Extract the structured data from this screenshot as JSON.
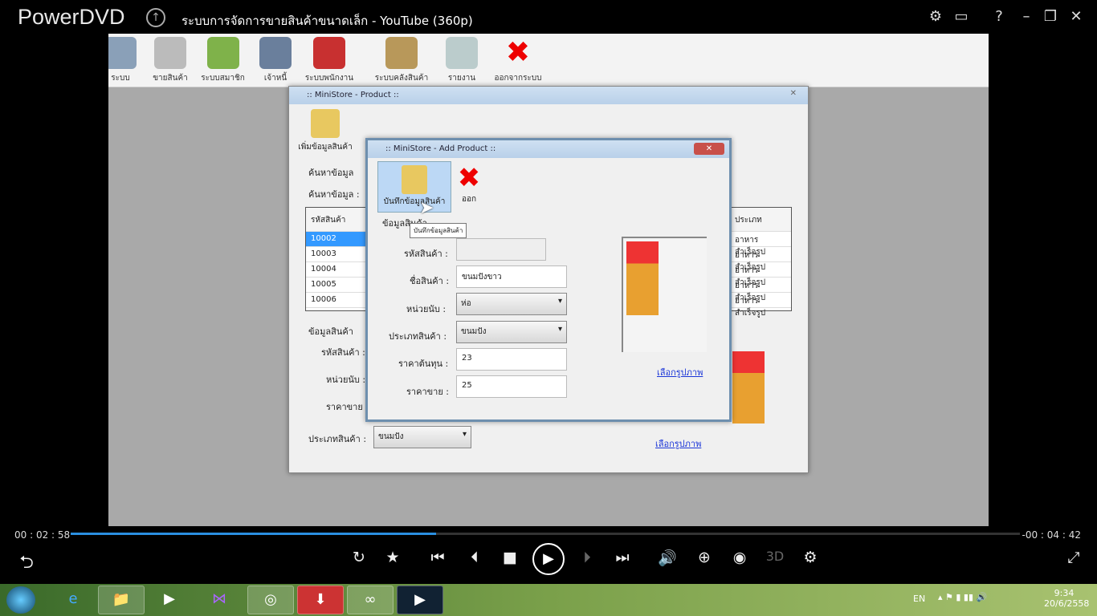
{
  "player": {
    "name": "PowerDVD",
    "video_title": "ระบบการจัดการขายสินค้าขนาดเล็ก - YouTube (360p)",
    "time_elapsed": "00 : 02 : 58",
    "time_remaining": "-00 : 04 : 42",
    "progress_percent": 38.5,
    "three_d": "3D"
  },
  "app_toolbar": [
    "ระบบ",
    "ขายสินค้า",
    "ระบบสมาชิก",
    "เจ้าหนี้",
    "ระบบพนักงาน",
    "ระบบคลังสินค้า",
    "รายงาน",
    "ออกจากระบบ"
  ],
  "product_window": {
    "title": ":: MiniStore - Product ::",
    "add_label": "เพิ่มข้อมูลสินค้า",
    "search_label1": "ค้นหาข้อมูล",
    "search_label2": "ค้นหาข้อมูล :",
    "list_header": "รหัสสินค้า",
    "list_header2": "ประเภท",
    "rows": [
      "10002",
      "10003",
      "10004",
      "10005",
      "10006"
    ],
    "types": [
      "อาหารสำเร็จรูป",
      "อาหารสำเร็จรูป",
      "อาหารสำเร็จรูป",
      "อาหารสำเร็จรูป",
      "อาหารสำเร็จรูป"
    ],
    "section": "ข้อมูลสินค้า",
    "f_code": "รหัสสินค้า :",
    "f_unit": "หน่วยนับ :",
    "f_price": "ราคาขาย :",
    "f_type": "ประเภทสินค้า :",
    "type_value": "ขนมปัง",
    "pick_image": "เลือกรูปภาพ"
  },
  "add_window": {
    "title": ":: MiniStore - Add Product ::",
    "save_label": "บันทึกข้อมูลสินค้า",
    "exit_label": "ออก",
    "tooltip": "บันทึกข้อมูลสินค้า",
    "section": "ข้อมูลสินค้า",
    "labels": {
      "code": "รหัสสินค้า :",
      "name": "ชื่อสินค้า :",
      "unit": "หน่วยนับ :",
      "type": "ประเภทสินค้า :",
      "cost": "ราคาต้นทุน :",
      "price": "ราคาขาย :"
    },
    "values": {
      "code": "",
      "name": "ขนมปังขาว",
      "unit": "ห่อ",
      "type": "ขนมปัง",
      "cost": "23",
      "price": "25"
    },
    "pick_image": "เลือกรูปภาพ"
  },
  "taskbar": {
    "lang": "EN",
    "time": "9:34",
    "date": "20/6/2558"
  }
}
